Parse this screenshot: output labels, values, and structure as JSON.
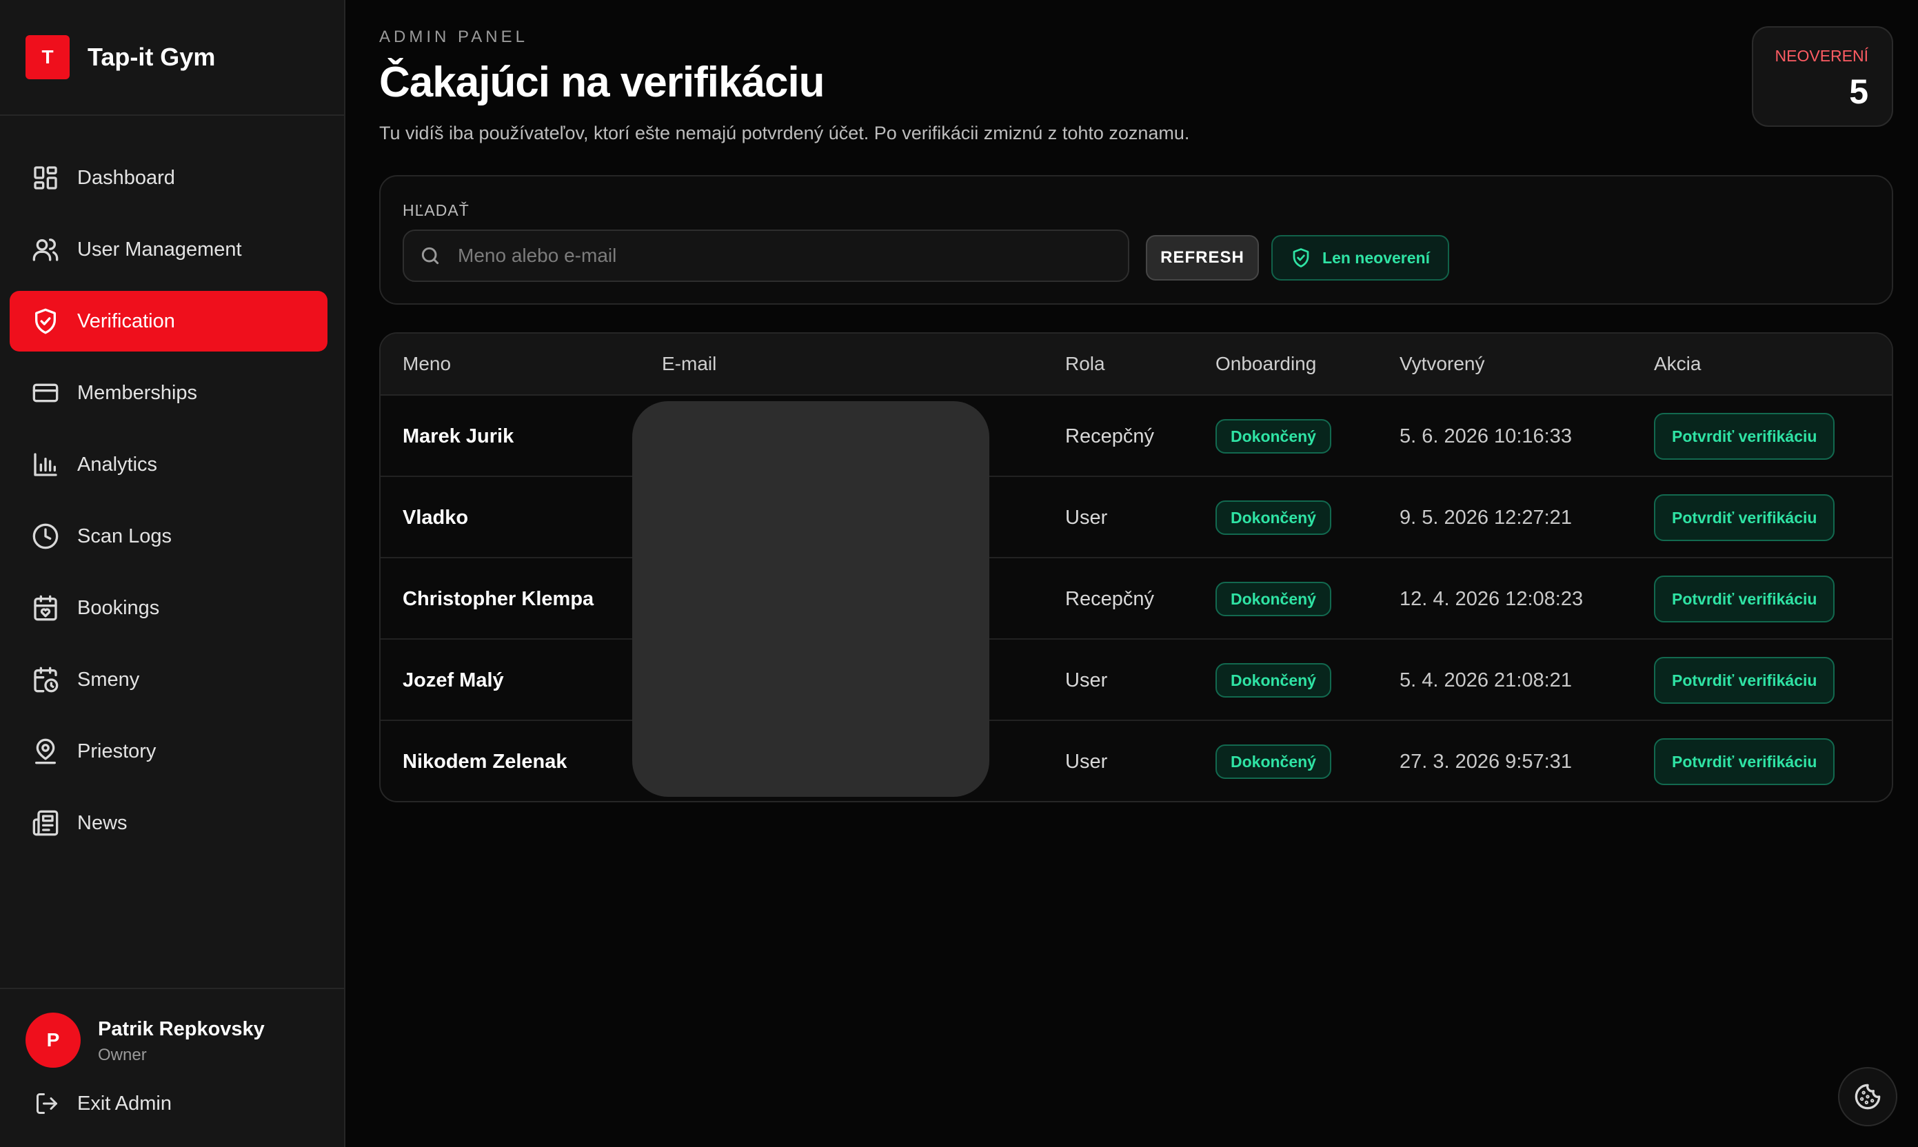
{
  "brand": {
    "logo_letter": "T",
    "name": "Tap-it Gym"
  },
  "nav": {
    "items": [
      {
        "label": "Dashboard",
        "icon": "dashboard-icon"
      },
      {
        "label": "User Management",
        "icon": "users-icon"
      },
      {
        "label": "Verification",
        "icon": "shield-check-icon",
        "active": true
      },
      {
        "label": "Memberships",
        "icon": "credit-card-icon"
      },
      {
        "label": "Analytics",
        "icon": "bar-chart-icon"
      },
      {
        "label": "Scan Logs",
        "icon": "clock-icon"
      },
      {
        "label": "Bookings",
        "icon": "calendar-heart-icon"
      },
      {
        "label": "Smeny",
        "icon": "calendar-clock-icon"
      },
      {
        "label": "Priestory",
        "icon": "map-pin-user-icon"
      },
      {
        "label": "News",
        "icon": "newspaper-icon"
      }
    ]
  },
  "user": {
    "avatar_letter": "P",
    "name": "Patrik Repkovsky",
    "role": "Owner",
    "exit_label": "Exit Admin"
  },
  "header": {
    "kicker": "ADMIN PANEL",
    "title": "Čakajúci na verifikáciu",
    "subtitle": "Tu vidíš iba používateľov, ktorí ešte nemajú potvrdený účet. Po verifikácii zmiznú z tohto zoznamu.",
    "count_label": "NEOVERENÍ",
    "count_value": "5"
  },
  "search": {
    "label": "HĽADAŤ",
    "placeholder": "Meno alebo e-mail",
    "value": "",
    "refresh_label": "REFRESH",
    "filter_label": "Len neoverení"
  },
  "table": {
    "columns": [
      "Meno",
      "E-mail",
      "Rola",
      "Onboarding",
      "Vytvorený",
      "Akcia"
    ],
    "rows": [
      {
        "name": "Marek Jurik",
        "email": "",
        "role": "Recepčný",
        "onboarding": "Dokončený",
        "created": "5. 6. 2026 10:16:33",
        "action": "Potvrdiť verifikáciu"
      },
      {
        "name": "Vladko",
        "email": "",
        "role": "User",
        "onboarding": "Dokončený",
        "created": "9. 5. 2026 12:27:21",
        "action": "Potvrdiť verifikáciu"
      },
      {
        "name": "Christopher Klempa",
        "email": "",
        "role": "Recepčný",
        "onboarding": "Dokončený",
        "created": "12. 4. 2026 12:08:23",
        "action": "Potvrdiť verifikáciu"
      },
      {
        "name": "Jozef Malý",
        "email": "",
        "role": "User",
        "onboarding": "Dokončený",
        "created": "5. 4. 2026 21:08:21",
        "action": "Potvrdiť verifikáciu"
      },
      {
        "name": "Nikodem Zelenak",
        "email": "",
        "role": "User",
        "onboarding": "Dokončený",
        "created": "27. 3. 2026 9:57:31",
        "action": "Potvrdiť verifikáciu"
      }
    ]
  },
  "colors": {
    "accent": "#ef0f1c",
    "success": "#2fe3a4",
    "background": "#060606",
    "panel": "#161616"
  }
}
